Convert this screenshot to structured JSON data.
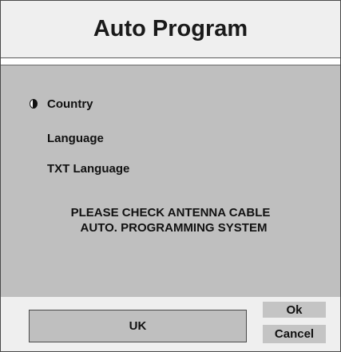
{
  "title": "Auto Program",
  "menu": {
    "items": [
      {
        "label": "Country",
        "selected": true
      },
      {
        "label": "Language",
        "selected": false
      },
      {
        "label": "TXT Language",
        "selected": false
      }
    ]
  },
  "message": {
    "line1": "PLEASE CHECK ANTENNA CABLE",
    "line2": "AUTO. PROGRAMMING SYSTEM"
  },
  "footer": {
    "value": "UK",
    "ok_label": "Ok",
    "cancel_label": "Cancel"
  },
  "icons": {
    "selector": "selection-indicator-icon"
  },
  "colors": {
    "content_bg": "#bfbfbf",
    "header_bg": "#efefef",
    "button_bg": "#c4c4c4",
    "text": "#111111"
  }
}
